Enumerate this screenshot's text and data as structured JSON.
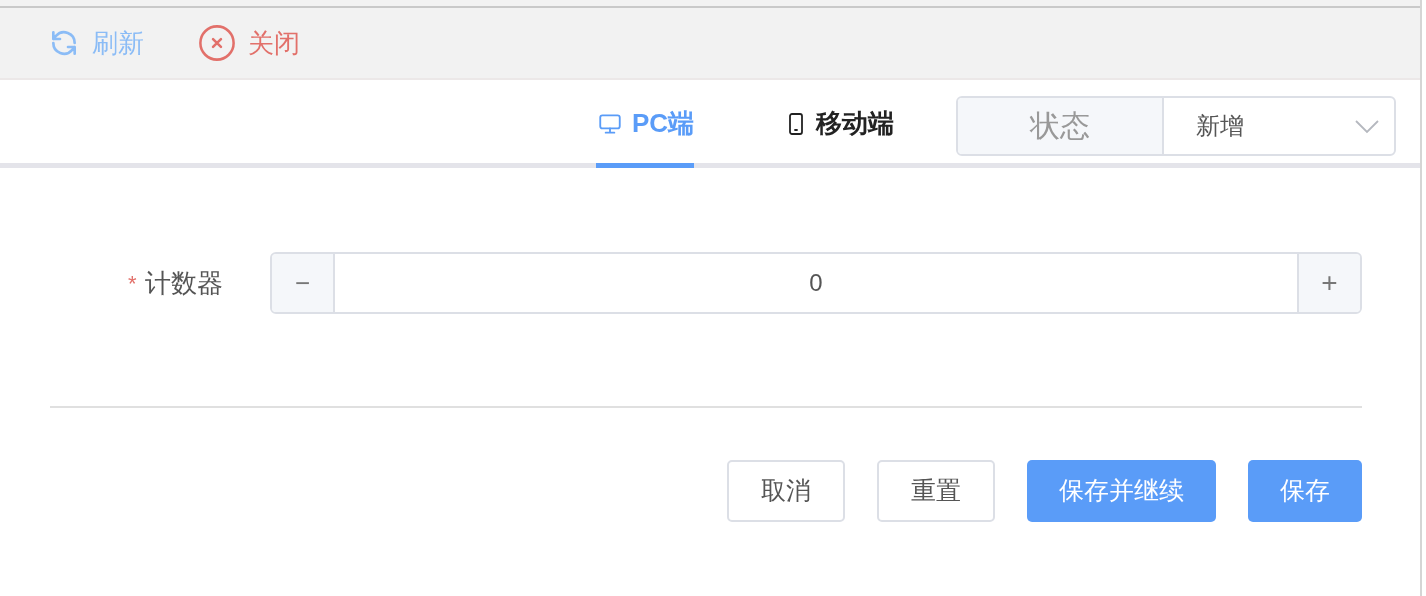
{
  "toolbar": [
    {
      "kind": "refresh",
      "label": "刷新"
    },
    {
      "kind": "close",
      "label": "关闭"
    }
  ],
  "tabs": [
    {
      "kind": "pc",
      "label": "PC端",
      "selected": true
    },
    {
      "kind": "mobile",
      "label": "移动端",
      "selected": false
    }
  ],
  "status_select": {
    "label": "状态",
    "value": "新增"
  },
  "form": {
    "field": {
      "label": "计数器",
      "required_mark": "*",
      "value": "0",
      "decrement": "−",
      "increment": "+"
    }
  },
  "buttons": [
    {
      "label": "取消",
      "kind": "default"
    },
    {
      "label": "重置",
      "kind": "default"
    },
    {
      "label": "保存并继续",
      "kind": "primary"
    },
    {
      "label": "保存",
      "kind": "primary"
    }
  ]
}
